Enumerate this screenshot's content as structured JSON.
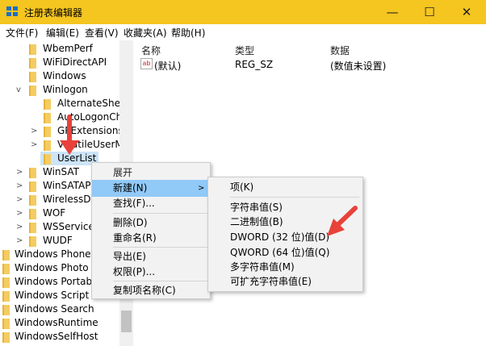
{
  "window": {
    "title": "注册表编辑器",
    "min_glyph": "—",
    "max_glyph": "☐",
    "close_glyph": "✕"
  },
  "menubar": [
    "文件(F)",
    "编辑(E)",
    "查看(V)",
    "收藏夹(A)",
    "帮助(H)"
  ],
  "tree": [
    {
      "label": "WbemPerf",
      "expander": ""
    },
    {
      "label": "WiFiDirectAPI",
      "expander": ""
    },
    {
      "label": "Windows",
      "expander": ""
    },
    {
      "label": "Winlogon",
      "expander": "v"
    },
    {
      "label": "AlternateShel",
      "expander": ""
    },
    {
      "label": "AutoLogonCh",
      "expander": ""
    },
    {
      "label": "GPExtensions",
      "expander": ">"
    },
    {
      "label": "VolatileUserM",
      "expander": ">"
    },
    {
      "label": "UserList",
      "expander": ""
    },
    {
      "label": "WinSAT",
      "expander": ">"
    },
    {
      "label": "WinSATAPI",
      "expander": ">"
    },
    {
      "label": "WirelessDoc",
      "expander": ">"
    },
    {
      "label": "WOF",
      "expander": ">"
    },
    {
      "label": "WSService",
      "expander": ">"
    },
    {
      "label": "WUDF",
      "expander": ">"
    },
    {
      "label": "Windows Phone",
      "expander": ""
    },
    {
      "label": "Windows Photo V",
      "expander": ""
    },
    {
      "label": "Windows Portab",
      "expander": ""
    },
    {
      "label": "Windows Script I",
      "expander": ""
    },
    {
      "label": "Windows Search",
      "expander": ""
    },
    {
      "label": "WindowsRuntime",
      "expander": ""
    },
    {
      "label": "WindowsSelfHost",
      "expander": ""
    }
  ],
  "list": {
    "headers": {
      "name": "名称",
      "type": "类型",
      "data": "数据"
    },
    "row": {
      "icon": "ab",
      "name": "(默认)",
      "type": "REG_SZ",
      "data": "(数值未设置)"
    }
  },
  "context_menu": {
    "items": [
      "展开",
      "新建(N)",
      "查找(F)...",
      "删除(D)",
      "重命名(R)",
      "导出(E)",
      "权限(P)...",
      "复制项名称(C)"
    ],
    "submenu_arrow": ">"
  },
  "submenu": {
    "items": [
      "项(K)",
      "字符串值(S)",
      "二进制值(B)",
      "DWORD (32 位)值(D)",
      "QWORD (64 位)值(Q)",
      "多字符串值(M)",
      "可扩充字符串值(E)"
    ]
  },
  "colors": {
    "titlebar": "#f5c520",
    "highlight": "#91c9f7",
    "selection": "#cce4f7",
    "annotation_arrow": "#e8423a"
  }
}
